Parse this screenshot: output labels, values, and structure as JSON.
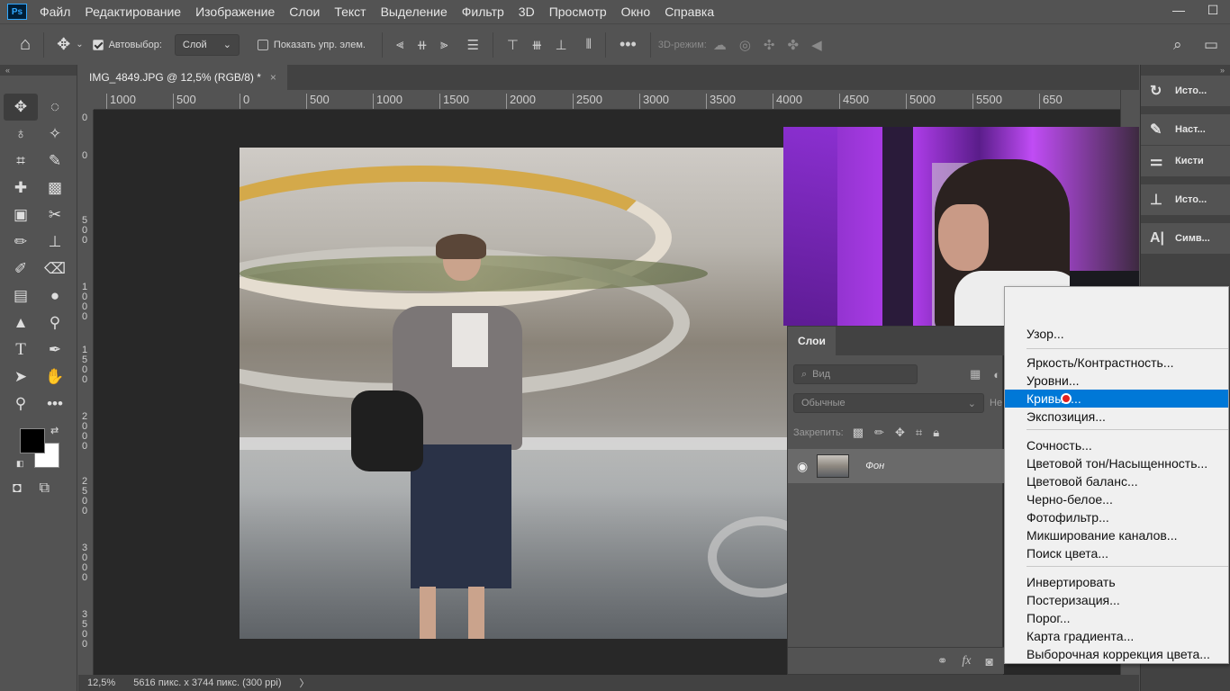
{
  "menubar": {
    "app_icon": "Ps",
    "items": [
      "Файл",
      "Редактирование",
      "Изображение",
      "Слои",
      "Текст",
      "Выделение",
      "Фильтр",
      "3D",
      "Просмотр",
      "Окно",
      "Справка"
    ]
  },
  "options": {
    "autoselect_label": "Автовыбор:",
    "autoselect_value": "Слой",
    "show_controls_label": "Показать упр. элем.",
    "mode3d_label": "3D-режим:"
  },
  "document": {
    "tab_title": "IMG_4849.JPG @ 12,5% (RGB/8) *",
    "close_glyph": "×"
  },
  "ruler": {
    "h_labels": [
      "1000",
      "500",
      "0",
      "500",
      "1000",
      "1500",
      "2000",
      "2500",
      "3000",
      "3500",
      "4000",
      "4500",
      "5000",
      "5500",
      "650"
    ],
    "v_labels": [
      "0",
      "0",
      "500",
      "1000",
      "1500",
      "2000",
      "2500",
      "3000",
      "3500"
    ]
  },
  "status": {
    "zoom": "12,5%",
    "doc_info": "5616 пикс. x 3744 пикс. (300 ppi)",
    "arrow": "〉"
  },
  "dock": {
    "items": [
      "Исто...",
      "Наст...",
      "Кисти",
      "Исто...",
      "Симв..."
    ]
  },
  "layers": {
    "tab": "Слои",
    "filter_placeholder": "Вид",
    "blend_mode": "Обычные",
    "blend_cut": "Не",
    "lock_label": "Закрепить:",
    "layer_name": "Фон",
    "footer_icons": [
      "link-icon",
      "fx-icon",
      "mask-icon"
    ],
    "fx_label": "fx"
  },
  "context_menu": {
    "groups": [
      [
        "Узор..."
      ],
      [
        "Яркость/Контрастность...",
        "Уровни...",
        "Кривые...",
        "Экспозиция..."
      ],
      [
        "Сочность...",
        "Цветовой тон/Насыщенность...",
        "Цветовой баланс...",
        "Черно-белое...",
        "Фотофильтр...",
        "Микширование каналов...",
        "Поиск цвета..."
      ],
      [
        "Инвертировать",
        "Постеризация...",
        "Порог...",
        "Карта градиента...",
        "Выборочная коррекция цвета..."
      ]
    ],
    "selected": "Кривые..."
  }
}
